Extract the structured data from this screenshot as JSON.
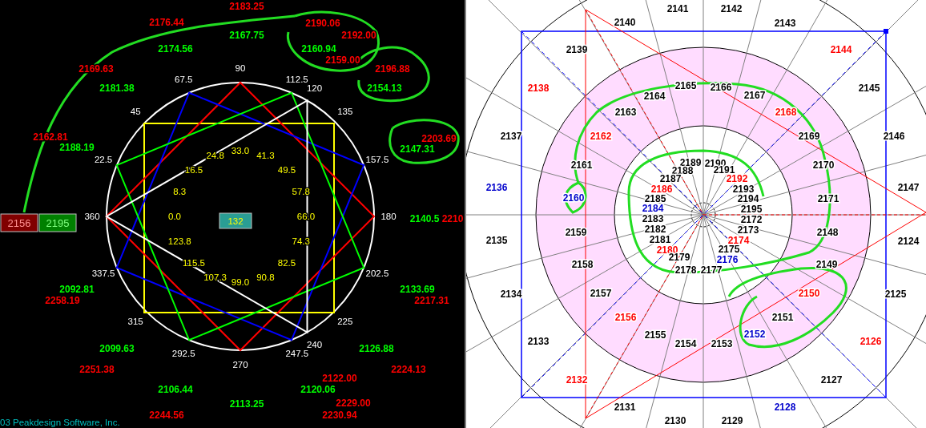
{
  "wheel_panel": {
    "degree_labels": [
      "90",
      "67.5",
      "112.5",
      "120",
      "45",
      "135",
      "22.5",
      "157.5",
      "360",
      "180",
      "337.5",
      "202.5",
      "315",
      "225",
      "292.5",
      "247.5",
      "240",
      "270"
    ],
    "inner_values": [
      "0.0",
      "8.3",
      "16.5",
      "24.8",
      "33.0",
      "41.3",
      "49.5",
      "57.8",
      "66.0",
      "74.3",
      "82.5",
      "90.8",
      "99.0",
      "107.3",
      "115.5",
      "123.8"
    ],
    "center_box": "132",
    "price_boxes": [
      {
        "text": "2156",
        "color": "#800000"
      },
      {
        "text": "2195",
        "color": "#008000"
      }
    ],
    "price_levels": [
      {
        "text": "2183.25",
        "color": "#ff0000"
      },
      {
        "text": "2176.44",
        "color": "#ff0000"
      },
      {
        "text": "2167.75",
        "color": "#00ff00"
      },
      {
        "text": "2190.06",
        "color": "#ff0000"
      },
      {
        "text": "2192.00",
        "color": "#ff0000"
      },
      {
        "text": "2160.94",
        "color": "#00ff00"
      },
      {
        "text": "2159.00",
        "color": "#ff0000"
      },
      {
        "text": "2174.56",
        "color": "#00ff00"
      },
      {
        "text": "2196.88",
        "color": "#ff0000"
      },
      {
        "text": "2154.13",
        "color": "#00ff00"
      },
      {
        "text": "2169.63",
        "color": "#ff0000"
      },
      {
        "text": "2181.38",
        "color": "#00ff00"
      },
      {
        "text": "2162.81",
        "color": "#ff0000"
      },
      {
        "text": "2188.19",
        "color": "#00ff00"
      },
      {
        "text": "2203.69",
        "color": "#ff0000"
      },
      {
        "text": "2147.31",
        "color": "#00ff00"
      },
      {
        "text": "2140.5",
        "color": "#00ff00"
      },
      {
        "text": "2210",
        "color": "#ff0000"
      },
      {
        "text": "2092.81",
        "color": "#00ff00"
      },
      {
        "text": "2258.19",
        "color": "#ff0000"
      },
      {
        "text": "2133.69",
        "color": "#00ff00"
      },
      {
        "text": "2217.31",
        "color": "#ff0000"
      },
      {
        "text": "2099.63",
        "color": "#00ff00"
      },
      {
        "text": "2251.38",
        "color": "#ff0000"
      },
      {
        "text": "2126.88",
        "color": "#00ff00"
      },
      {
        "text": "2224.13",
        "color": "#ff0000"
      },
      {
        "text": "2122.00",
        "color": "#ff0000"
      },
      {
        "text": "2106.44",
        "color": "#00ff00"
      },
      {
        "text": "2120.06",
        "color": "#00ff00"
      },
      {
        "text": "2113.25",
        "color": "#00ff00"
      },
      {
        "text": "2229.00",
        "color": "#ff0000"
      },
      {
        "text": "2244.56",
        "color": "#ff0000"
      },
      {
        "text": "2230.94",
        "color": "#ff0000"
      }
    ],
    "footer": "03 Peakdesign Software, Inc."
  },
  "square_panel": {
    "numbers": [
      {
        "text": "2140",
        "color": "#000000"
      },
      {
        "text": "2141",
        "color": "#000000"
      },
      {
        "text": "2142",
        "color": "#000000"
      },
      {
        "text": "2143",
        "color": "#000000"
      },
      {
        "text": "2139",
        "color": "#000000"
      },
      {
        "text": "2144",
        "color": "#ff0000"
      },
      {
        "text": "2138",
        "color": "#ff0000"
      },
      {
        "text": "2145",
        "color": "#000000"
      },
      {
        "text": "2137",
        "color": "#000000"
      },
      {
        "text": "2146",
        "color": "#000000"
      },
      {
        "text": "2136",
        "color": "#0000cc"
      },
      {
        "text": "2147",
        "color": "#000000"
      },
      {
        "text": "2135",
        "color": "#000000"
      },
      {
        "text": "2124",
        "color": "#000000"
      },
      {
        "text": "2134",
        "color": "#000000"
      },
      {
        "text": "2125",
        "color": "#000000"
      },
      {
        "text": "2133",
        "color": "#000000"
      },
      {
        "text": "2126",
        "color": "#ff0000"
      },
      {
        "text": "2132",
        "color": "#ff0000"
      },
      {
        "text": "2127",
        "color": "#000000"
      },
      {
        "text": "2131",
        "color": "#000000"
      },
      {
        "text": "2128",
        "color": "#0000cc"
      },
      {
        "text": "2130",
        "color": "#000000"
      },
      {
        "text": "2129",
        "color": "#000000"
      },
      {
        "text": "2165",
        "color": "#000000"
      },
      {
        "text": "2166",
        "color": "#000000"
      },
      {
        "text": "2164",
        "color": "#000000"
      },
      {
        "text": "2167",
        "color": "#000000"
      },
      {
        "text": "2163",
        "color": "#000000"
      },
      {
        "text": "2168",
        "color": "#ff0000"
      },
      {
        "text": "2162",
        "color": "#ff0000"
      },
      {
        "text": "2169",
        "color": "#000000"
      },
      {
        "text": "2161",
        "color": "#000000"
      },
      {
        "text": "2170",
        "color": "#000000"
      },
      {
        "text": "2160",
        "color": "#0000cc"
      },
      {
        "text": "2171",
        "color": "#000000"
      },
      {
        "text": "2159",
        "color": "#000000"
      },
      {
        "text": "2148",
        "color": "#000000"
      },
      {
        "text": "2158",
        "color": "#000000"
      },
      {
        "text": "2149",
        "color": "#000000"
      },
      {
        "text": "2157",
        "color": "#000000"
      },
      {
        "text": "2150",
        "color": "#ff0000"
      },
      {
        "text": "2156",
        "color": "#ff0000"
      },
      {
        "text": "2151",
        "color": "#000000"
      },
      {
        "text": "2155",
        "color": "#000000"
      },
      {
        "text": "2152",
        "color": "#0000cc"
      },
      {
        "text": "2154",
        "color": "#000000"
      },
      {
        "text": "2153",
        "color": "#000000"
      },
      {
        "text": "2189",
        "color": "#000000"
      },
      {
        "text": "2190",
        "color": "#000000"
      },
      {
        "text": "2188",
        "color": "#000000"
      },
      {
        "text": "2191",
        "color": "#000000"
      },
      {
        "text": "2187",
        "color": "#000000"
      },
      {
        "text": "2186",
        "color": "#ff0000"
      },
      {
        "text": "2192",
        "color": "#ff0000"
      },
      {
        "text": "2185",
        "color": "#000000"
      },
      {
        "text": "2193",
        "color": "#000000"
      },
      {
        "text": "2184",
        "color": "#0000cc"
      },
      {
        "text": "2194",
        "color": "#000000"
      },
      {
        "text": "2183",
        "color": "#000000"
      },
      {
        "text": "2195",
        "color": "#000000"
      },
      {
        "text": "2182",
        "color": "#000000"
      },
      {
        "text": "2172",
        "color": "#000000"
      },
      {
        "text": "2181",
        "color": "#000000"
      },
      {
        "text": "2173",
        "color": "#000000"
      },
      {
        "text": "2180",
        "color": "#ff0000"
      },
      {
        "text": "2174",
        "color": "#ff0000"
      },
      {
        "text": "2179",
        "color": "#000000"
      },
      {
        "text": "2175",
        "color": "#000000"
      },
      {
        "text": "2178",
        "color": "#000000"
      },
      {
        "text": "2177",
        "color": "#000000"
      },
      {
        "text": "2176",
        "color": "#0000cc"
      }
    ]
  }
}
